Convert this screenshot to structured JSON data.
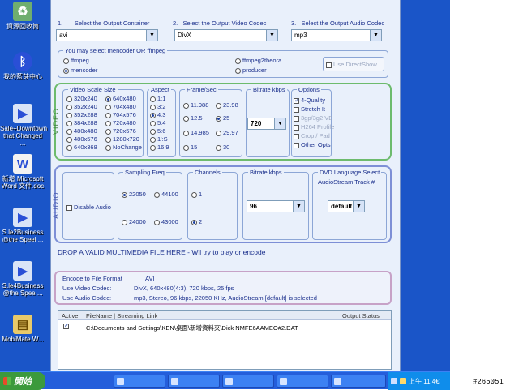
{
  "desktop": {
    "icons": [
      {
        "name": "recycle-bin-icon",
        "label": "資源回收筒",
        "color": "#6fae6f",
        "glyph": "♻"
      },
      {
        "name": "bluetooth-icon",
        "label": "我的藍芽中心",
        "color": "#2a4fd6",
        "glyph": "ᛒ"
      },
      {
        "name": "media-file-icon-1",
        "label": "Sale+Downtown\nthat Changed ...",
        "color": "#d9e4f7",
        "glyph": "▶"
      },
      {
        "name": "word-doc-icon",
        "label": "新增 Microsoft\nWord 文件.doc",
        "color": "#f2f2f2",
        "glyph": "W"
      },
      {
        "name": "media-file-icon-2",
        "label": "S.le2Business\n@the Speel ...",
        "color": "#d9e4f7",
        "glyph": "▶"
      },
      {
        "name": "media-file-icon-3",
        "label": "S.le4Business\n@the Spee ...",
        "color": "#d9e4f7",
        "glyph": "▶"
      },
      {
        "name": "mobimate-icon",
        "label": "MobiMate W...",
        "color": "#e8c96a",
        "glyph": "▤"
      }
    ]
  },
  "taskbar": {
    "start_label": "開始",
    "tasks": [
      "",
      "",
      "",
      "",
      "",
      ""
    ],
    "clock": "上午 11:4€"
  },
  "photo_id": "#265051",
  "header": {
    "container_label": "Select the Output Container",
    "container_num": "1.",
    "container_value": "avi",
    "video_codec_label": "Select the Output Video Codec",
    "video_codec_num": "2.",
    "video_codec_value": "DivX",
    "audio_codec_label": "Select the Output Audio Codec",
    "audio_codec_num": "3.",
    "audio_codec_value": "mp3"
  },
  "encoder": {
    "title": "You may select mencoder OR ffmpeg",
    "options": [
      "ffmpeg",
      "mencoder",
      "ffmpeg2theora",
      "producer"
    ],
    "selected": "mencoder",
    "direct_show": "Use DirectShow"
  },
  "video": {
    "section_label": "VIDEO",
    "scale_title": "Video Scale Size",
    "scale_sizes": [
      "320x240",
      "352x240",
      "352x288",
      "384x288",
      "480x480",
      "480x576",
      "640x368",
      "640x480",
      "704x480",
      "704x576",
      "720x480",
      "720x576",
      "1280x720",
      "NoChange"
    ],
    "scale_selected": "640x480",
    "aspect_title": "Aspect",
    "aspects": [
      "1:1",
      "3:2",
      "4:3",
      "5:4",
      "5:6",
      "1':S",
      "16:9"
    ],
    "aspect_selected": "4:3",
    "framerate_title": "Frame/Sec",
    "framerates": [
      "11.988",
      "23.98",
      "12.5",
      "25",
      "14.985",
      "29.97",
      "15",
      "30"
    ],
    "framerate_selected": "25",
    "bitrate_title": "Bitrate kbps",
    "bitrate_value": "720",
    "options_title": "Options",
    "options": [
      {
        "label": "4-Quality",
        "checked": true,
        "dim": false
      },
      {
        "label": "Stretch It",
        "checked": false,
        "dim": false
      },
      {
        "label": "3gp/3g2 VB",
        "checked": false,
        "dim": true
      },
      {
        "label": "H264 Profile",
        "checked": false,
        "dim": true
      },
      {
        "label": "Crop / Pad",
        "checked": false,
        "dim": true
      },
      {
        "label": "Other Opts",
        "checked": false,
        "dim": false
      }
    ]
  },
  "audio": {
    "section_label": "AUDIO",
    "disable_label": "Disable Audio",
    "sampling_title": "Sampling Freq",
    "sampling": [
      "22050",
      "44100",
      "24000",
      "43000"
    ],
    "sampling_selected": "22050",
    "channels_title": "Channels",
    "channels": [
      "1",
      "2"
    ],
    "channels_selected": "2",
    "bitrate_title": "Bitrate kbps",
    "bitrate_value": "96",
    "dvd_title_1": "DVD Language Select",
    "dvd_title_2": "AudioStream Track #",
    "dvd_value": "default"
  },
  "drop_text": "DROP A VALID MULTIMEDIA FILE HERE - Wil try to play or encode",
  "summary": {
    "format_label": "Encode to File Format",
    "format_value": "AVI",
    "video_label": "Use Video Codec:",
    "video_value": "DivX, 640x480(4:3), 720 kbps, 25 fps",
    "audio_label": "Use Audio Codec:",
    "audio_value": "mp3, Stereo, 96 kbps, 22050 KHz, AudioStream [default] is selected"
  },
  "queue": {
    "col_active": "Active",
    "col_filename": "FileName  |  Streaming Link",
    "col_status": "Output Status",
    "row_path": "C:\\Documents and Settings\\KEN\\桌面\\新增資料夾\\Dick NMFE6AAMEO#2.DAT"
  }
}
